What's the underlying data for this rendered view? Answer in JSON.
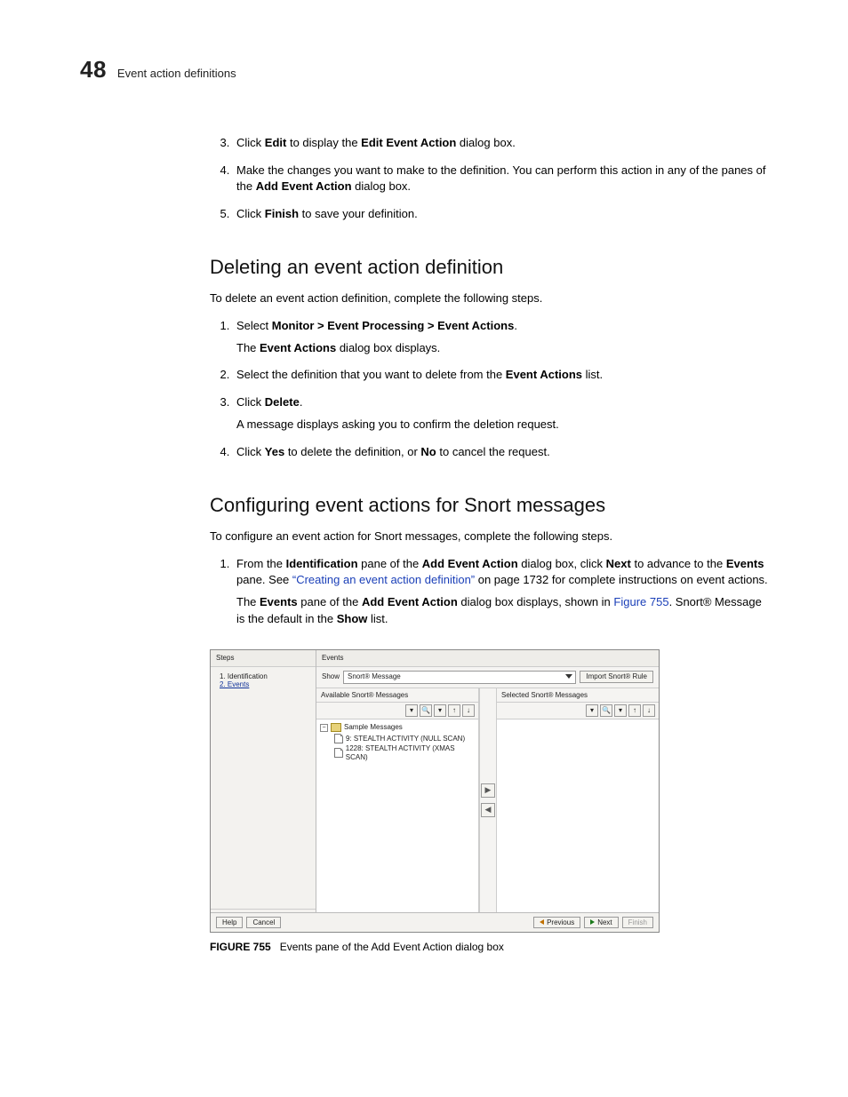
{
  "header": {
    "chapter": "48",
    "title": "Event action definitions"
  },
  "steps_a": [
    {
      "n": "3.",
      "html": "Click <b>Edit</b> to display the <b>Edit Event Action</b> dialog box."
    },
    {
      "n": "4.",
      "html": "Make the changes you want to make to the definition. You can perform this action in any of the panes of the <b>Add Event Action</b> dialog box."
    },
    {
      "n": "5.",
      "html": "Click <b>Finish</b> to save your definition."
    }
  ],
  "sec1": {
    "title": "Deleting an event action definition",
    "intro": "To delete an event action definition, complete the following steps."
  },
  "steps_b": [
    {
      "n": "1.",
      "html": "Select <b>Monitor > Event Processing > Event Actions</b>.",
      "sub": "The <b>Event Actions</b> dialog box displays."
    },
    {
      "n": "2.",
      "html": "Select the definition that you want to delete from the <b>Event Actions</b> list."
    },
    {
      "n": "3.",
      "html": "Click <b>Delete</b>.",
      "sub": "A message displays asking you to confirm the deletion request."
    },
    {
      "n": "4.",
      "html": "Click <b>Yes</b> to delete the definition, or <b>No</b> to cancel the request."
    }
  ],
  "sec2": {
    "title": "Configuring event actions for Snort messages",
    "intro": "To configure an event action for Snort messages, complete the following steps."
  },
  "steps_c": [
    {
      "n": "1.",
      "html": "From the <b>Identification</b> pane of the <b>Add Event Action</b> dialog box, click <b>Next</b> to advance to the <b>Events</b> pane. See <a class=\"link\" href=\"#\">“Creating an event action definition”</a> on page 1732 for complete instructions on event actions.",
      "sub": "The <b>Events</b> pane of the <b>Add Event Action</b> dialog box displays, shown in <a class=\"link\" href=\"#\">Figure 755</a>. Snort® Message is the default in the <b>Show</b> list."
    }
  ],
  "dialog": {
    "steps_label": "Steps",
    "events_label": "Events",
    "step1": "1. Identification",
    "step2": "2. Events",
    "show_label": "Show",
    "show_value": "Snort® Message",
    "import_btn": "Import Snort® Rule",
    "left_title": "Available Snort® Messages",
    "right_title": "Selected Snort® Messages",
    "tree_root": "Sample Messages",
    "tree_leaf1": "9: STEALTH ACTIVITY (NULL SCAN)",
    "tree_leaf2": "1228: STEALTH ACTIVITY (XMAS SCAN)",
    "help": "Help",
    "cancel": "Cancel",
    "prev": "Previous",
    "next": "Next",
    "finish": "Finish"
  },
  "figcap": {
    "label": "FIGURE 755",
    "text": "Events pane of the Add Event Action dialog box"
  }
}
